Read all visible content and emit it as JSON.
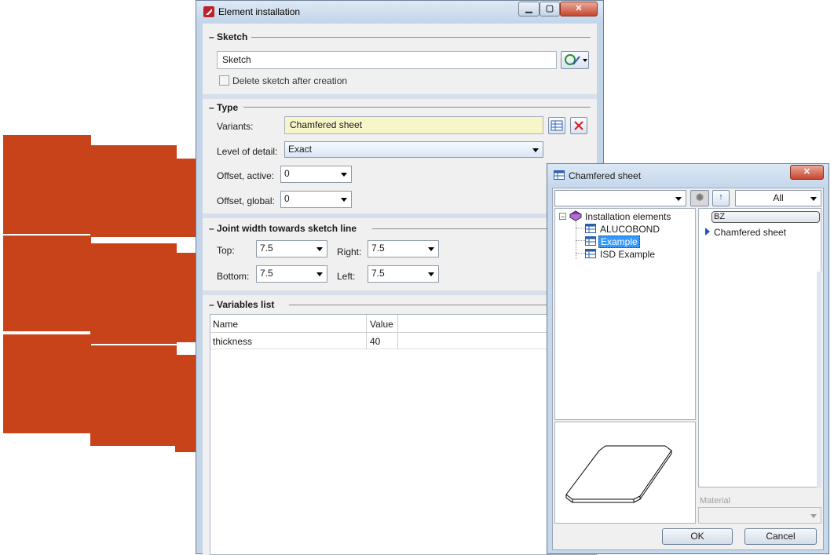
{
  "main_window": {
    "title": "Element installation",
    "sketch": {
      "heading": "Sketch",
      "field_value": "Sketch",
      "delete_checkbox_label": "Delete sketch after creation"
    },
    "type": {
      "heading": "Type",
      "variants_label": "Variants:",
      "variants_value": "Chamfered sheet",
      "level_label": "Level of detail:",
      "level_value": "Exact",
      "offset_active_label": "Offset, active:",
      "offset_active_value": "0",
      "offset_global_label": "Offset, global:",
      "offset_global_value": "0"
    },
    "joint": {
      "heading": "Joint width towards sketch line",
      "top_label": "Top:",
      "top_value": "7.5",
      "right_label": "Right:",
      "right_value": "7.5",
      "bottom_label": "Bottom:",
      "bottom_value": "7.5",
      "left_label": "Left:",
      "left_value": "7.5"
    },
    "variables": {
      "heading": "Variables list",
      "columns": [
        "Name",
        "Value"
      ],
      "rows": [
        {
          "name": "thickness",
          "value": "40"
        }
      ]
    }
  },
  "dialog": {
    "title": "Chamfered sheet",
    "filter_value": "All",
    "tree": {
      "root": "Installation elements",
      "items": [
        "ALUCOBOND",
        "Example",
        "ISD Example"
      ],
      "selected": "Example"
    },
    "list_header": "BZ",
    "list_items": [
      "Chamfered sheet"
    ],
    "material_label": "Material",
    "ok_label": "OK",
    "cancel_label": "Cancel"
  },
  "colors": {
    "panel": "#c9431a",
    "variants_bg": "#f8f6c8",
    "selection": "#3399ff"
  }
}
